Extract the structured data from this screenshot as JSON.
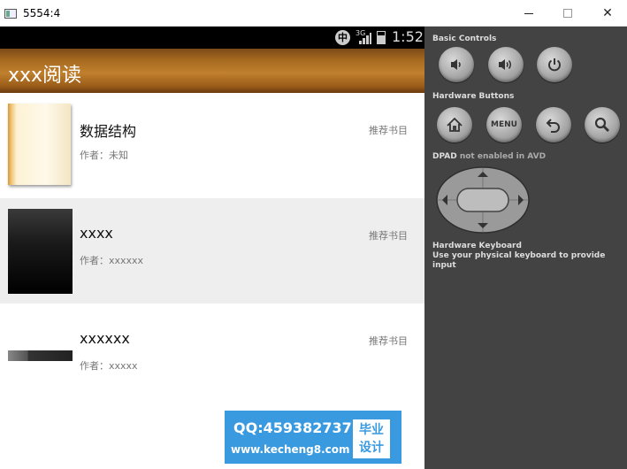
{
  "window": {
    "title": "5554:4",
    "minimize_glyph": "",
    "maximize_glyph": "",
    "close_glyph": "✕"
  },
  "statusbar": {
    "ime": "中",
    "network": "3G",
    "time": "1:52"
  },
  "app": {
    "title": "xxx阅读"
  },
  "books": [
    {
      "name": "数据结构",
      "author": "作者：未知",
      "tag": "推荐书目"
    },
    {
      "name": "xxxx",
      "author": "作者：xxxxxx",
      "tag": "推荐书目"
    },
    {
      "name": "xxxxxx",
      "author": "作者：xxxxx",
      "tag": "推荐书目"
    }
  ],
  "watermark": {
    "qq": "QQ:459382737",
    "site": "www.kecheng8.com",
    "badge_line1": "毕业",
    "badge_line2": "设计"
  },
  "panel": {
    "basic_controls": "Basic Controls",
    "hardware_buttons": "Hardware Buttons",
    "menu_label": "MENU",
    "dpad_prefix": "DPAD",
    "dpad_status": "not enabled in AVD",
    "keyboard_title": "Hardware Keyboard",
    "keyboard_hint": "Use your physical keyboard to provide input"
  },
  "icons": {
    "volume_down": "volume-down-icon",
    "volume_up": "volume-up-icon",
    "power": "power-icon",
    "home": "home-icon",
    "back": "back-icon",
    "search": "search-icon"
  }
}
